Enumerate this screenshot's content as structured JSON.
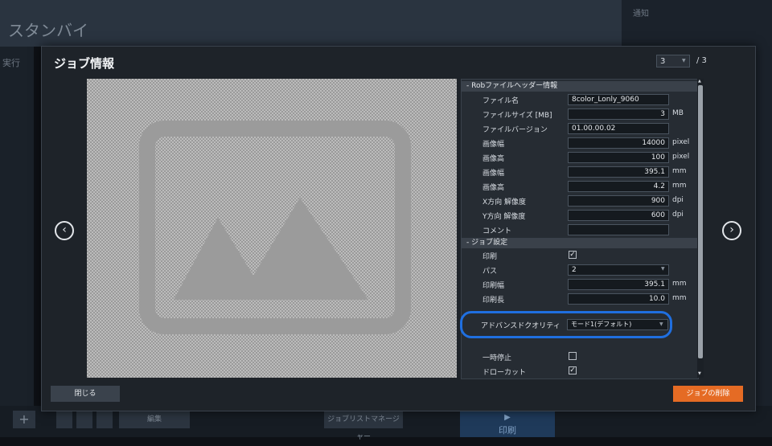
{
  "background": {
    "title": "スタンバイ",
    "notifications_label": "通知",
    "left_label": "実行",
    "edit_button": "編集",
    "manager_button": "ジョブリストマネージャー",
    "print_button": "印刷",
    "print_icon": "play-arrow-icon",
    "add_button": "+"
  },
  "modal": {
    "title": "ジョブ情報",
    "page_current": "3",
    "page_total": "/ 3",
    "prev_icon": "chevron-left-circle-icon",
    "next_icon": "chevron-right-circle-icon",
    "close_button": "閉じる",
    "delete_button": "ジョブの削除",
    "delete_color": "#e56b24",
    "highlight_color": "#1f6fe0"
  },
  "header_section": {
    "title": "- Robファイルヘッダー情報",
    "rows": [
      {
        "label": "ファイル名",
        "value": "8color_Lonly_9060",
        "unit": ""
      },
      {
        "label": "ファイルサイズ [MB]",
        "value": "3",
        "unit": "MB"
      },
      {
        "label": "ファイルバージョン",
        "value": "01.00.00.02",
        "unit": ""
      },
      {
        "label": "画像幅",
        "value": "14000",
        "unit": "pixel"
      },
      {
        "label": "画像高",
        "value": "100",
        "unit": "pixel"
      },
      {
        "label": "画像幅",
        "value": "395.1",
        "unit": "mm"
      },
      {
        "label": "画像高",
        "value": "4.2",
        "unit": "mm"
      },
      {
        "label": "X方向 解像度",
        "value": "900",
        "unit": "dpi"
      },
      {
        "label": "Y方向 解像度",
        "value": "600",
        "unit": "dpi"
      },
      {
        "label": "コメント",
        "value": "",
        "unit": ""
      }
    ]
  },
  "job_section": {
    "title": "- ジョブ設定",
    "print_label": "印刷",
    "pass_label": "パス",
    "pass_value": "2",
    "print_width_label": "印刷幅",
    "print_width_value": "395.1",
    "print_width_unit": "mm",
    "print_length_label": "印刷長",
    "print_length_value": "10.0",
    "print_length_unit": "mm",
    "quality_label": "アドバンスドクオリティ",
    "quality_value": "モード1(デフォルト)",
    "pause_label": "一時停止",
    "drawcut_label": "ドローカット"
  }
}
